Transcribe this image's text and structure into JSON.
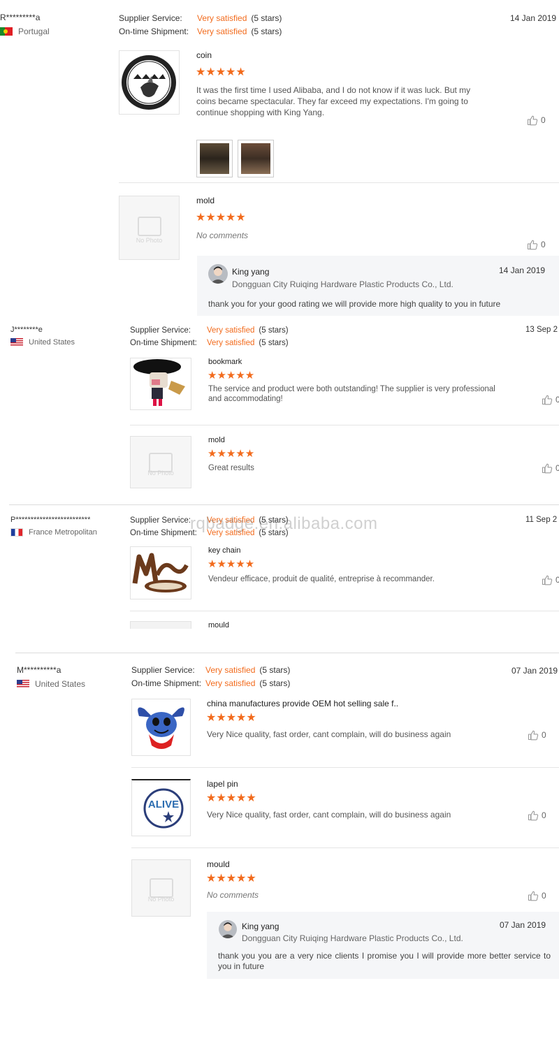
{
  "labels": {
    "supplier_service": "Supplier Service:",
    "ontime_shipment": "On-time Shipment:",
    "like_icon": "thumbs-up-icon",
    "no_photo": "No Photo"
  },
  "colors": {
    "accent": "#f26b1d",
    "reply_bg": "#f5f6f8"
  },
  "watermark": "rqbadge.en.alibaba.com",
  "reviews": [
    {
      "buyer": "R*********a",
      "country": "Portugal",
      "flag": "portugal-flag-icon",
      "date": "14 Jan 2019",
      "supplier_service": "Very satisfied",
      "supplier_service_stars": "(5 stars)",
      "ontime_shipment": "Very satisfied",
      "ontime_shipment_stars": "(5 stars)",
      "items": [
        {
          "product": "coin",
          "rating": 5,
          "stars": "★★★★★",
          "comment": "It was the first time I used Alibaba, and I do not know if it was luck. But my coins became spectacular. They far exceed my expectations. I'm going to continue shopping with King Yang.",
          "likes": "0"
        },
        {
          "product": "mold",
          "rating": 5,
          "stars": "★★★★★",
          "comment": "No comments",
          "likes": "0",
          "reply": {
            "name": "King yang",
            "company": "Dongguan City Ruiqing Hardware Plastic Products Co., Ltd.",
            "date": "14 Jan 2019",
            "text": "thank you for your good rating we will provide more high quality to you in future"
          }
        }
      ]
    },
    {
      "buyer": "J********e",
      "country": "United States",
      "flag": "usa-flag-icon",
      "date": "13 Sep 2",
      "supplier_service": "Very satisfied",
      "supplier_service_stars": "(5 stars)",
      "ontime_shipment": "Very satisfied",
      "ontime_shipment_stars": "(5 stars)",
      "items": [
        {
          "product": "bookmark",
          "rating": 5,
          "stars": "★★★★★",
          "comment": "The service and product were both outstanding! The supplier is very professional and accommodating!",
          "likes": "0"
        },
        {
          "product": "mold",
          "rating": 5,
          "stars": "★★★★★",
          "comment": "Great results",
          "likes": "0"
        }
      ]
    },
    {
      "buyer": "P*************************",
      "country": "France Metropolitan",
      "flag": "france-flag-icon",
      "date": "11 Sep 2",
      "supplier_service": "Very satisfied",
      "supplier_service_stars": "(5 stars)",
      "ontime_shipment": "Very satisfied",
      "ontime_shipment_stars": "(5 stars)",
      "items": [
        {
          "product": "key chain",
          "rating": 5,
          "stars": "★★★★★",
          "comment": "Vendeur efficace, produit de qualité, entreprise à recommander.",
          "likes": "0"
        },
        {
          "product": "mould"
        }
      ]
    },
    {
      "buyer": "M**********a",
      "country": "United States",
      "flag": "usa-flag-icon",
      "date": "07 Jan 2019",
      "supplier_service": "Very satisfied",
      "supplier_service_stars": "(5 stars)",
      "ontime_shipment": "Very satisfied",
      "ontime_shipment_stars": "(5 stars)",
      "items": [
        {
          "product": "china manufactures provide OEM hot selling sale f..",
          "rating": 5,
          "stars": "★★★★★",
          "comment": "Very Nice quality, fast order, cant complain, will do business again",
          "likes": "0"
        },
        {
          "product": "lapel pin",
          "rating": 5,
          "stars": "★★★★★",
          "comment": "Very Nice quality, fast order, cant complain, will do business again",
          "likes": "0"
        },
        {
          "product": "mould",
          "rating": 5,
          "stars": "★★★★★",
          "comment": "No comments",
          "likes": "0",
          "reply": {
            "name": "King yang",
            "company": "Dongguan City Ruiqing Hardware Plastic Products Co., Ltd.",
            "date": "07 Jan 2019",
            "text": "thank you you are a very nice clients I promise you I will provide more better service to you in future"
          }
        }
      ]
    }
  ]
}
